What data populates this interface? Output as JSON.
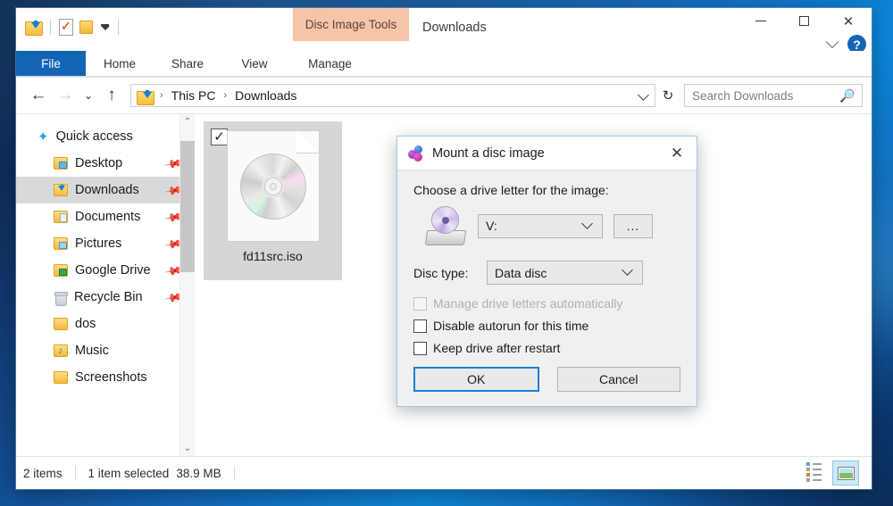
{
  "window": {
    "title": "Downloads",
    "contextual_tab": "Disc Image Tools",
    "quick_access_icons": [
      "downloads-folder-icon",
      "properties-icon",
      "new-folder-icon",
      "customize-dropdown-icon"
    ],
    "controls": {
      "minimize": "minimize-button",
      "maximize": "maximize-button",
      "close": "✕"
    },
    "ribbon_collapse": "chevron-down-icon",
    "help": "?"
  },
  "ribbon": {
    "tabs": [
      {
        "label": "File",
        "active": true
      },
      {
        "label": "Home",
        "active": false
      },
      {
        "label": "Share",
        "active": false
      },
      {
        "label": "View",
        "active": false
      },
      {
        "label": "Manage",
        "active": false
      }
    ]
  },
  "address": {
    "back": "←",
    "forward": "→",
    "recent": "⌄",
    "up": "↑",
    "crumbs": [
      "This PC",
      "Downloads"
    ],
    "separator": "›",
    "refresh": "↻",
    "dropdown": "chevron-down-icon"
  },
  "search": {
    "placeholder": "Search Downloads",
    "icon": "search-icon"
  },
  "sidebar": {
    "items": [
      {
        "label": "Quick access",
        "icon": "star-icon",
        "level": "root",
        "pinned": false,
        "selected": false
      },
      {
        "label": "Desktop",
        "icon": "folder-desktop-icon",
        "level": "child",
        "pinned": true,
        "selected": false
      },
      {
        "label": "Downloads",
        "icon": "folder-downloads-icon",
        "level": "child",
        "pinned": true,
        "selected": true
      },
      {
        "label": "Documents",
        "icon": "folder-documents-icon",
        "level": "child",
        "pinned": true,
        "selected": false
      },
      {
        "label": "Pictures",
        "icon": "folder-pictures-icon",
        "level": "child",
        "pinned": true,
        "selected": false
      },
      {
        "label": "Google Drive",
        "icon": "folder-google-drive-icon",
        "level": "child",
        "pinned": true,
        "selected": false
      },
      {
        "label": "Recycle Bin",
        "icon": "recycle-bin-icon",
        "level": "child",
        "pinned": true,
        "selected": false
      },
      {
        "label": "dos",
        "icon": "folder-icon",
        "level": "child",
        "pinned": false,
        "selected": false
      },
      {
        "label": "Music",
        "icon": "folder-music-icon",
        "level": "child",
        "pinned": false,
        "selected": false
      },
      {
        "label": "Screenshots",
        "icon": "folder-icon",
        "level": "child",
        "pinned": false,
        "selected": false
      }
    ],
    "scroll_up": "⌃",
    "scroll_down": "⌄"
  },
  "files": [
    {
      "name": "fd11src.iso",
      "icon": "iso-disc-image-icon",
      "checked": true,
      "selected": true
    }
  ],
  "status": {
    "item_count": "2 items",
    "selection": "1 item selected",
    "size": "38.9 MB",
    "views": [
      {
        "name": "details-view-button",
        "active": false
      },
      {
        "name": "large-icons-view-button",
        "active": true
      }
    ]
  },
  "dialog": {
    "title": "Mount a disc image",
    "icon": "wincdemu-icon",
    "close": "✕",
    "prompt": "Choose a drive letter for the image:",
    "drive_icon": "disc-drive-icon",
    "drive_letter": "V:",
    "browse_label": "...",
    "disc_type_label": "Disc type:",
    "disc_type_value": "Data disc",
    "checkboxes": [
      {
        "label": "Manage drive letters automatically",
        "checked": false,
        "disabled": true
      },
      {
        "label": "Disable autorun for this time",
        "checked": false,
        "disabled": false
      },
      {
        "label": "Keep drive after restart",
        "checked": false,
        "disabled": false
      }
    ],
    "ok_label": "OK",
    "cancel_label": "Cancel"
  },
  "colors": {
    "accent": "#1265b5",
    "contextual_tab": "#f6c5a9",
    "selection": "#d9d9d9",
    "desktop": "#1266b8"
  }
}
